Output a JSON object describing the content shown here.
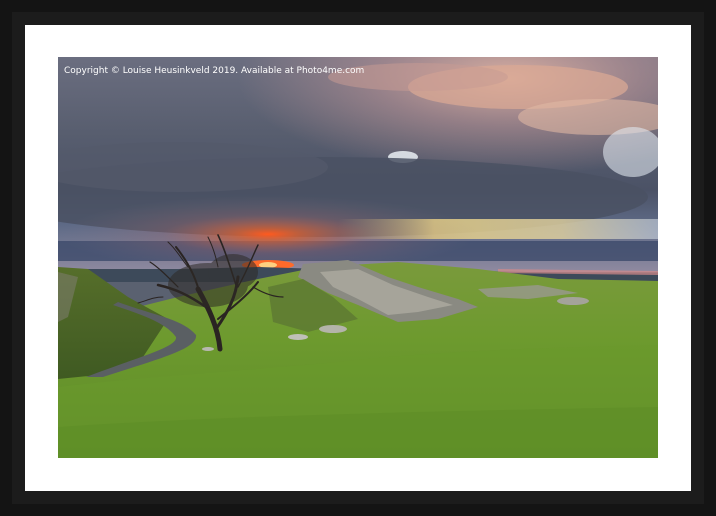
{
  "watermark": {
    "text": "Copyright  © Louise Heusinkveld  2019. Available at Photo4me.com"
  },
  "colors": {
    "frame": "#141414",
    "mount": "#ffffff",
    "grass": "#6e9a2e",
    "sky_storm": "#5b6172",
    "sunset_glow": "#f26a2a"
  }
}
